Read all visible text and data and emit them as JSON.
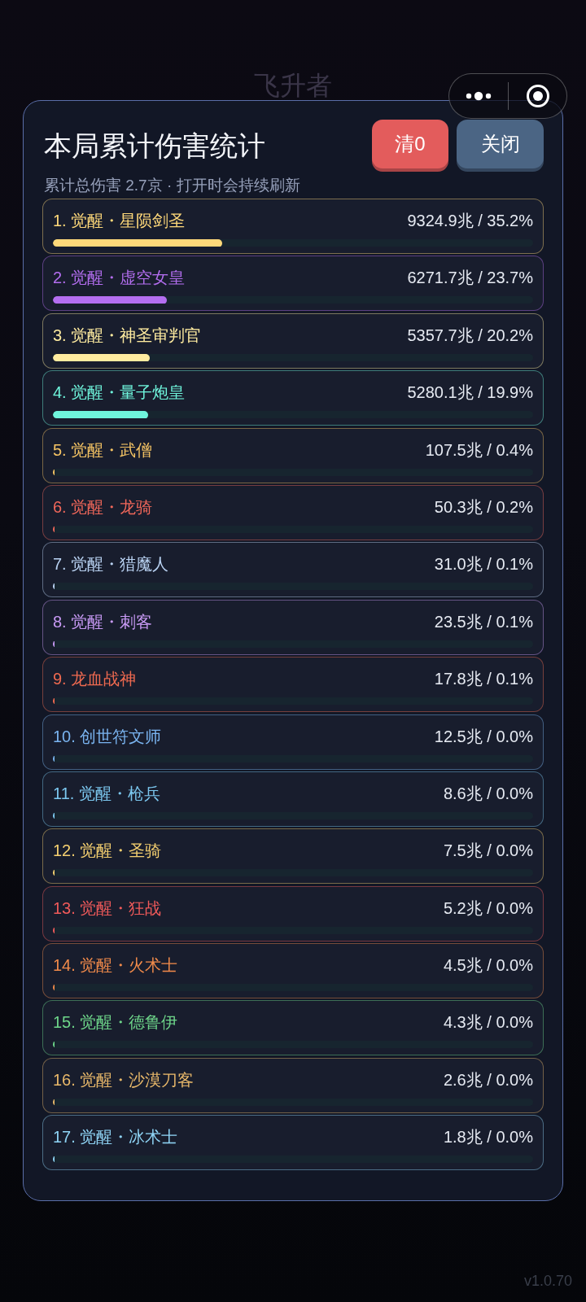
{
  "background": {
    "title": "飞升者",
    "version": "v1.0.70"
  },
  "dialog": {
    "title": "本局累计伤害统计",
    "buttons": [
      {
        "label": "清0",
        "kind": "danger"
      },
      {
        "label": "关闭",
        "kind": "secondary"
      }
    ],
    "summary": "累计总伤害 2.7京 · 打开时会持续刷新",
    "rows": [
      {
        "name": "1. 觉醒・星陨剑圣",
        "value": "9324.9兆 / 35.2%",
        "level": 0.352,
        "color": "#ffd97a"
      },
      {
        "name": "2. 觉醒・虚空女皇",
        "value": "6271.7兆 / 23.7%",
        "level": 0.237,
        "color": "#b46ef0"
      },
      {
        "name": "3. 觉醒・神圣审判官",
        "value": "5357.7兆 / 20.2%",
        "level": 0.202,
        "color": "#ffeca0"
      },
      {
        "name": "4. 觉醒・量子炮皇",
        "value": "5280.1兆 / 19.9%",
        "level": 0.199,
        "color": "#6ff5dc"
      },
      {
        "name": "5. 觉醒・武僧",
        "value": "107.5兆 / 0.4%",
        "level": 0.004,
        "color": "#f5c464"
      },
      {
        "name": "6. 觉醒・龙骑",
        "value": "50.3兆 / 0.2%",
        "level": 0.002,
        "color": "#f0675a"
      },
      {
        "name": "7. 觉醒・猎魔人",
        "value": "31.0兆 / 0.1%",
        "level": 0.001,
        "color": "#b9d2f2"
      },
      {
        "name": "8. 觉醒・刺客",
        "value": "23.5兆 / 0.1%",
        "level": 0.001,
        "color": "#c89af5"
      },
      {
        "name": "9. 龙血战神",
        "value": "17.8兆 / 0.1%",
        "level": 0.001,
        "color": "#f06a50"
      },
      {
        "name": "10. 创世符文师",
        "value": "12.5兆 / 0.0%",
        "level": 0.0,
        "color": "#7ab4f0"
      },
      {
        "name": "11. 觉醒・枪兵",
        "value": "8.6兆 / 0.0%",
        "level": 0.0,
        "color": "#7cc8f0"
      },
      {
        "name": "12. 觉醒・圣骑",
        "value": "7.5兆 / 0.0%",
        "level": 0.0,
        "color": "#f5d070"
      },
      {
        "name": "13. 觉醒・狂战",
        "value": "5.2兆 / 0.0%",
        "level": 0.0,
        "color": "#f05a5a"
      },
      {
        "name": "14. 觉醒・火术士",
        "value": "4.5兆 / 0.0%",
        "level": 0.0,
        "color": "#f08a4a"
      },
      {
        "name": "15. 觉醒・德鲁伊",
        "value": "4.3兆 / 0.0%",
        "level": 0.0,
        "color": "#6ed68a"
      },
      {
        "name": "16. 觉醒・沙漠刀客",
        "value": "2.6兆 / 0.0%",
        "level": 0.0,
        "color": "#e8b86a"
      },
      {
        "name": "17. 觉醒・冰术士",
        "value": "1.8兆 / 0.0%",
        "level": 0.0,
        "color": "#8fd4f5"
      }
    ]
  }
}
